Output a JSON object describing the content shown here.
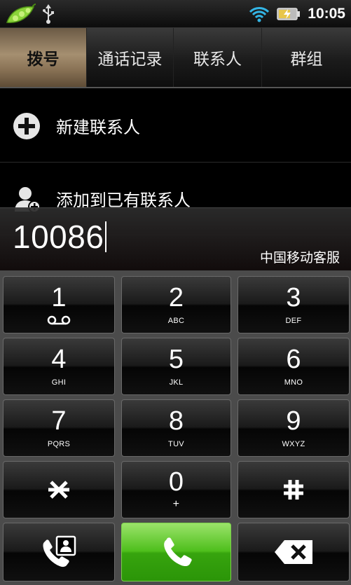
{
  "statusbar": {
    "time": "10:05"
  },
  "tabs": [
    {
      "label": "拨号",
      "active": true
    },
    {
      "label": "通话记录",
      "active": false
    },
    {
      "label": "联系人",
      "active": false
    },
    {
      "label": "群组",
      "active": false
    }
  ],
  "list": [
    {
      "label": "新建联系人",
      "icon": "plus-circle-icon"
    },
    {
      "label": "添加到已有联系人",
      "icon": "add-contact-icon"
    }
  ],
  "display": {
    "number": "10086",
    "carrier": "中国移动客服"
  },
  "keypad": [
    {
      "digit": "1",
      "letters": ""
    },
    {
      "digit": "2",
      "letters": "ABC"
    },
    {
      "digit": "3",
      "letters": "DEF"
    },
    {
      "digit": "4",
      "letters": "GHI"
    },
    {
      "digit": "5",
      "letters": "JKL"
    },
    {
      "digit": "6",
      "letters": "MNO"
    },
    {
      "digit": "7",
      "letters": "PQRS"
    },
    {
      "digit": "8",
      "letters": "TUV"
    },
    {
      "digit": "9",
      "letters": "WXYZ"
    },
    {
      "digit": "0",
      "letters": "+"
    }
  ],
  "colors": {
    "call_green": "#4fbf1d",
    "tab_active": "#a58f70"
  }
}
